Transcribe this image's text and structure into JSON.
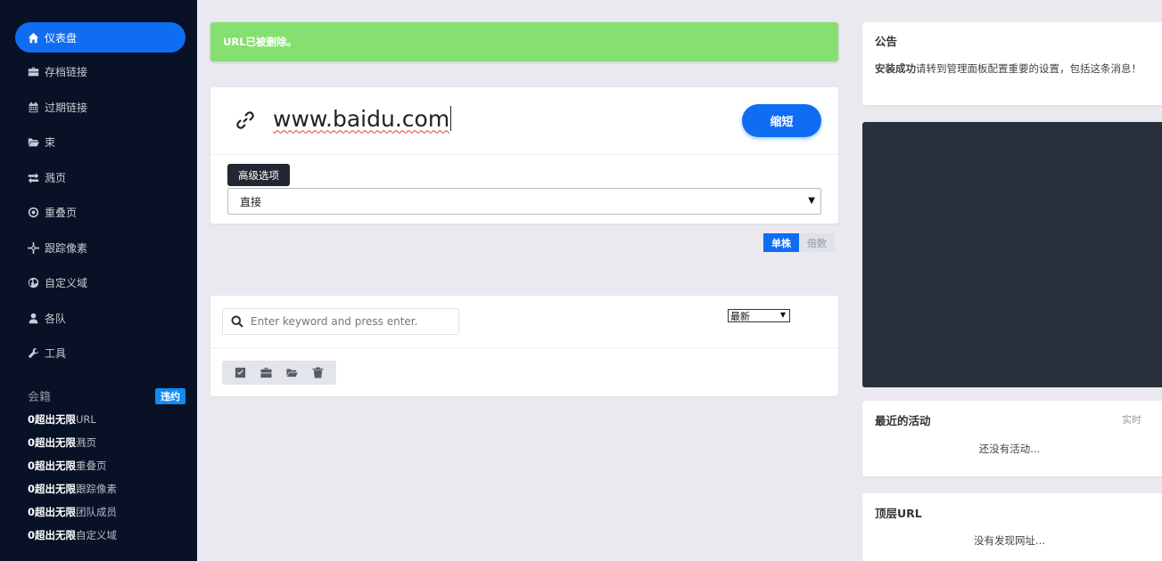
{
  "sidebar": {
    "items": [
      {
        "label": "仪表盘",
        "icon": "home-icon",
        "active": true
      },
      {
        "label": "存档链接",
        "icon": "briefcase-icon"
      },
      {
        "label": "过期链接",
        "icon": "calendar-icon"
      },
      {
        "label": "束",
        "icon": "folder-open-icon"
      },
      {
        "label": "溅页",
        "icon": "exchange-icon"
      },
      {
        "label": "重叠页",
        "icon": "dot-circle-icon"
      },
      {
        "label": "跟踪像素",
        "icon": "crosshair-icon"
      },
      {
        "label": "自定义域",
        "icon": "globe-icon"
      },
      {
        "label": "各队",
        "icon": "user-icon"
      },
      {
        "label": "工具",
        "icon": "wrench-icon"
      }
    ],
    "plan": {
      "title": "会籍",
      "badge": "违约",
      "limits": [
        {
          "count": "0超出无限",
          "label": "URL"
        },
        {
          "count": "0超出无限",
          "label": "溅页"
        },
        {
          "count": "0超出无限",
          "label": "重叠页"
        },
        {
          "count": "0超出无限",
          "label": "跟踪像素"
        },
        {
          "count": "0超出无限",
          "label": "团队成员"
        },
        {
          "count": "0超出无限",
          "label": "自定义域"
        }
      ]
    }
  },
  "alert": {
    "message": "URL已被删除。",
    "color": "#85e070"
  },
  "shorten": {
    "url_value": "www.baidu.com",
    "button_label": "缩短",
    "advanced_label": "高级选项",
    "redirect_type": "直接",
    "modes": {
      "single": "单株",
      "multiple": "倍数"
    }
  },
  "links": {
    "search_placeholder": "Enter keyword and press enter.",
    "sort_value": "最新"
  },
  "notice": {
    "title": "公告",
    "bold": "安装成功",
    "text": "请转到管理面板配置重要的设置，包括这条消息！"
  },
  "activity": {
    "title": "最近的活动",
    "realtime_label": "实时",
    "empty": "还没有活动..."
  },
  "top_urls": {
    "title": "顶层URL",
    "empty": "没有发现网址..."
  },
  "colors": {
    "accent": "#0f6df2",
    "sidebar_bg": "#081126",
    "dark_panel": "#29303b"
  }
}
